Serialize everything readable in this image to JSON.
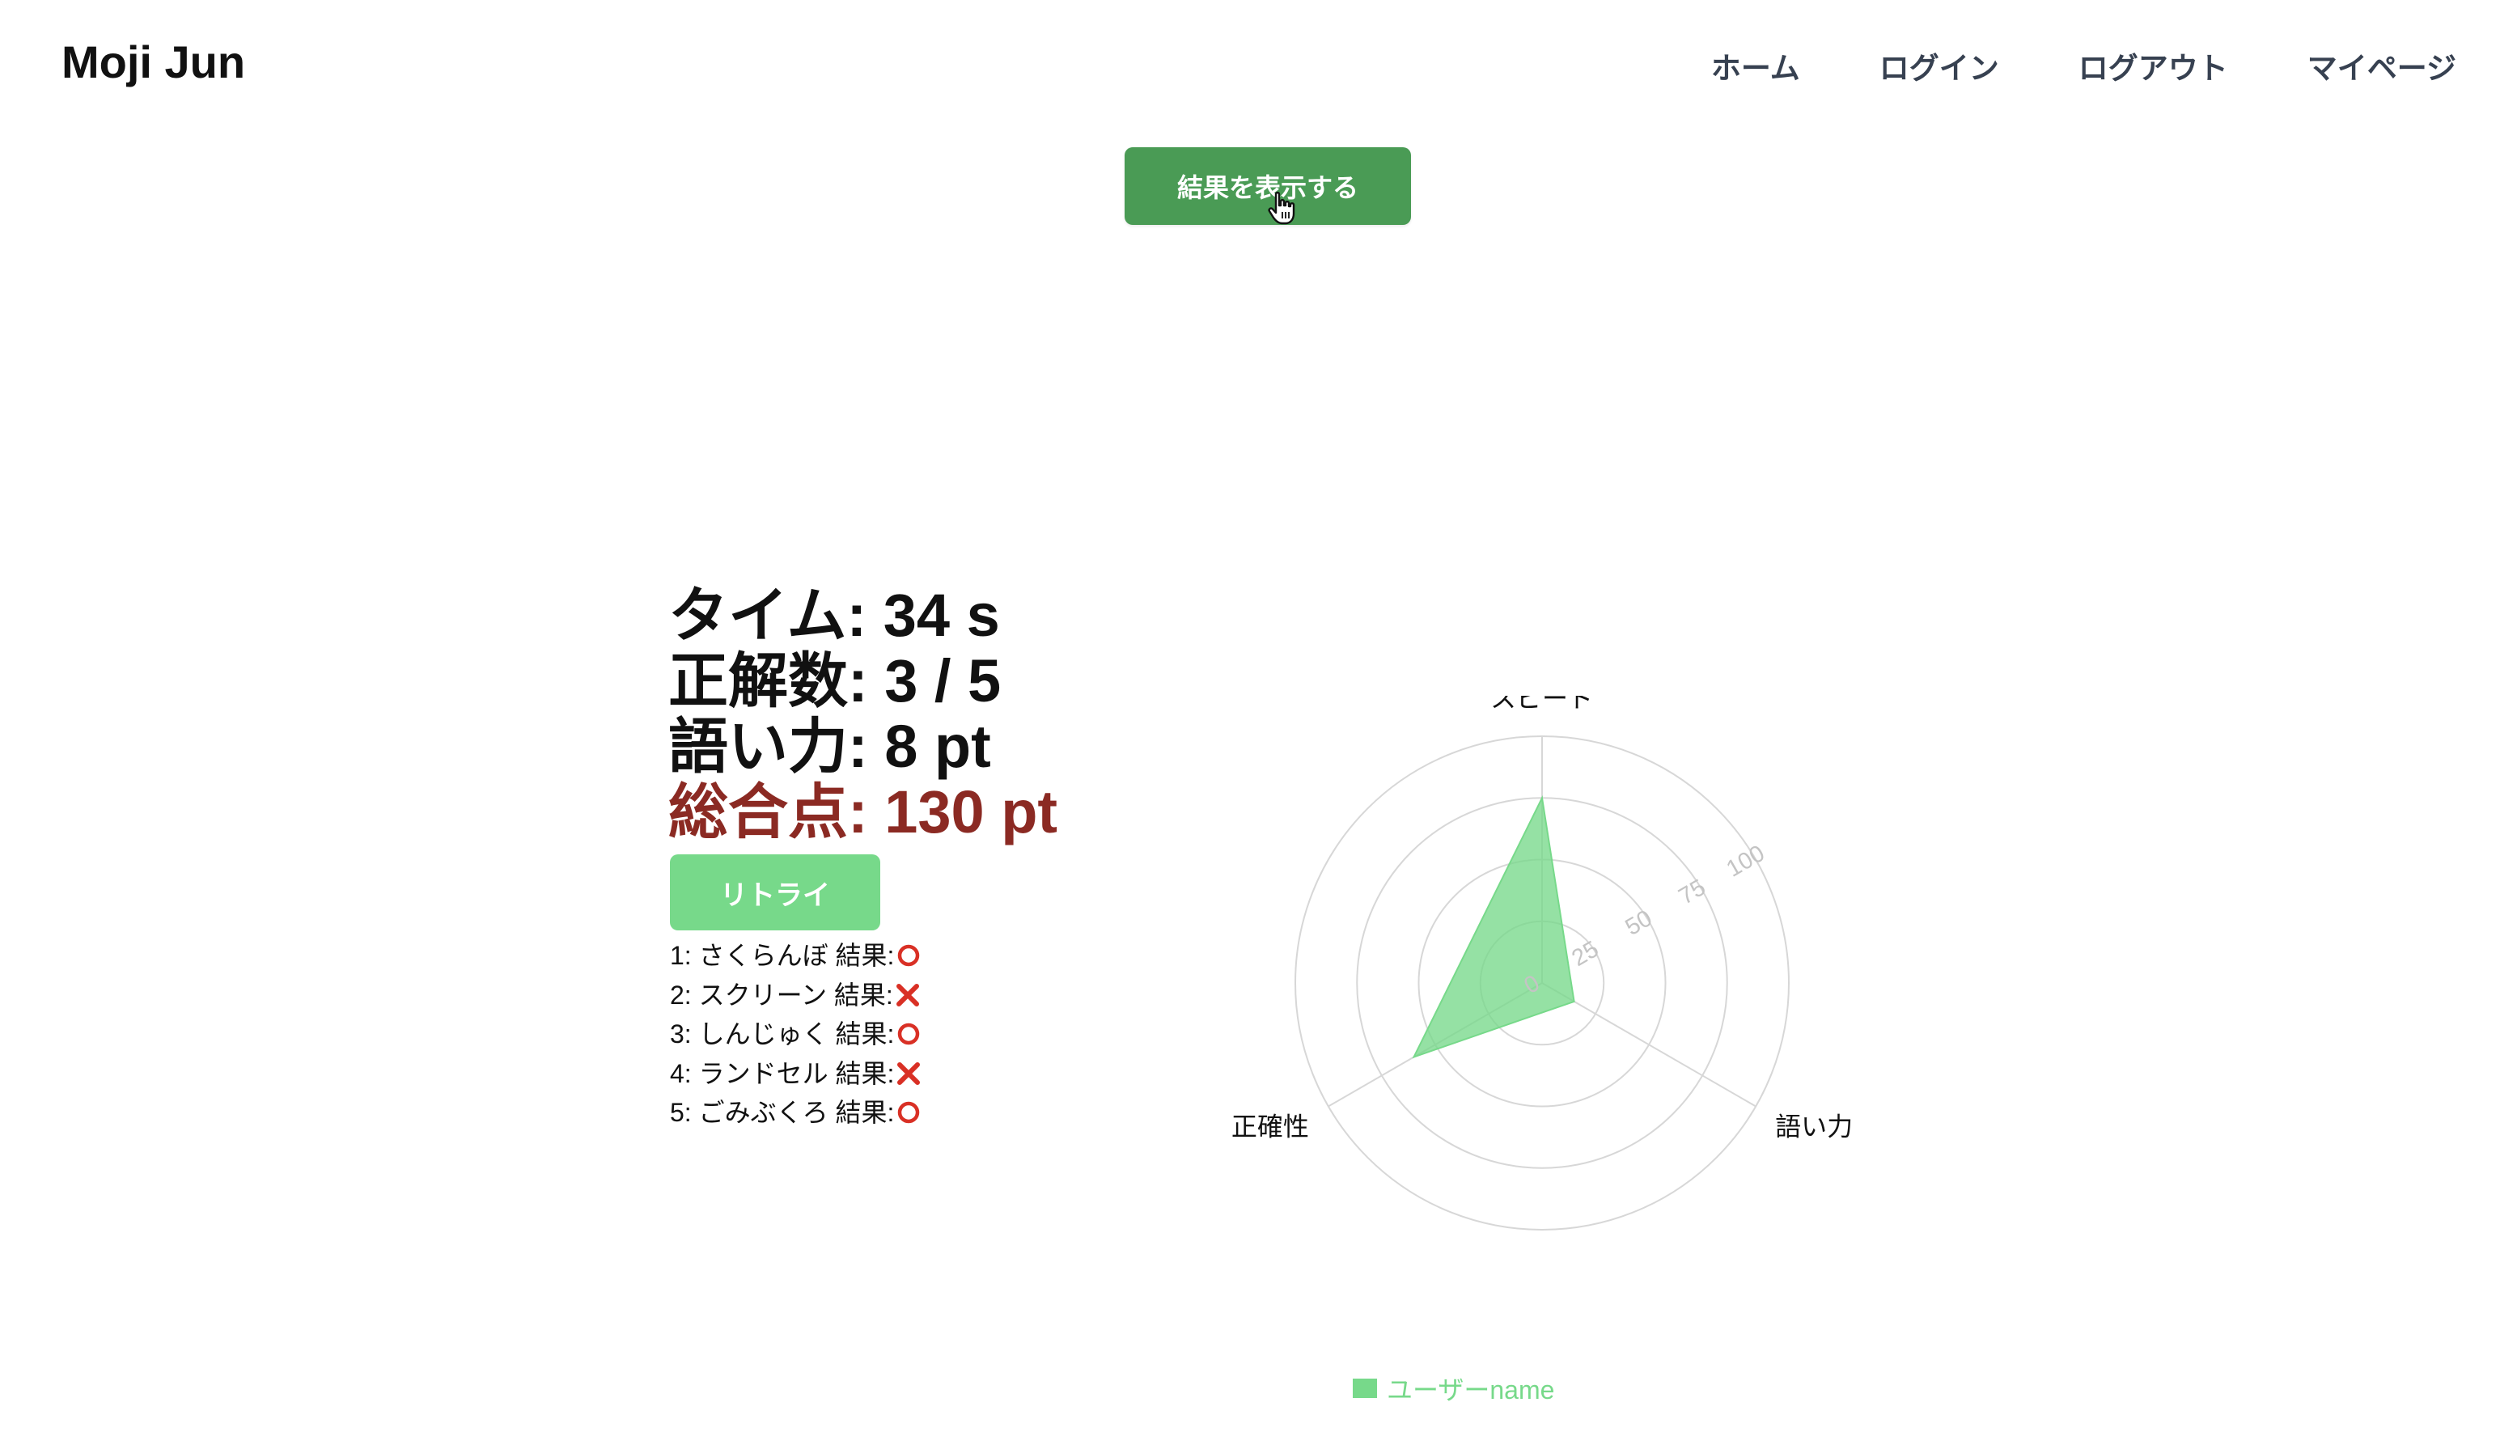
{
  "header": {
    "brand": "Moji Jun",
    "nav": [
      "ホーム",
      "ログイン",
      "ログアウト",
      "マイページ"
    ]
  },
  "show_result_button": "結果を表示する",
  "stats": {
    "time": "タイム: 34 s",
    "correct": "正解数: 3 / 5",
    "vocab": "語い力: 8 pt",
    "total": "総合点: 130 pt"
  },
  "retry_button": "リトライ",
  "results": [
    {
      "label": "1: さくらんぼ 結果:",
      "mark": "circle"
    },
    {
      "label": "2: スクリーン 結果:",
      "mark": "cross"
    },
    {
      "label": "3: しんじゅく 結果:",
      "mark": "circle"
    },
    {
      "label": "4: ランドセル 結果:",
      "mark": "cross"
    },
    {
      "label": "5: ごみぶくろ 結果:",
      "mark": "circle"
    }
  ],
  "colors": {
    "brand_green": "#4a9b55",
    "retry_green": "#77d98a",
    "series_fill": "#77d98a",
    "total_red": "#8b2a23",
    "mark_red": "#d93025",
    "grid": "#d7d7d7"
  },
  "chart_data": {
    "type": "radar",
    "axes": [
      "スピード",
      "語い力",
      "正確性"
    ],
    "ticks": [
      "0",
      "25",
      "50",
      "75",
      "100"
    ],
    "range": [
      0,
      100
    ],
    "series": [
      {
        "name": "ユーザーname",
        "values": [
          75,
          15,
          60
        ]
      }
    ],
    "legend_position": "bottom"
  }
}
